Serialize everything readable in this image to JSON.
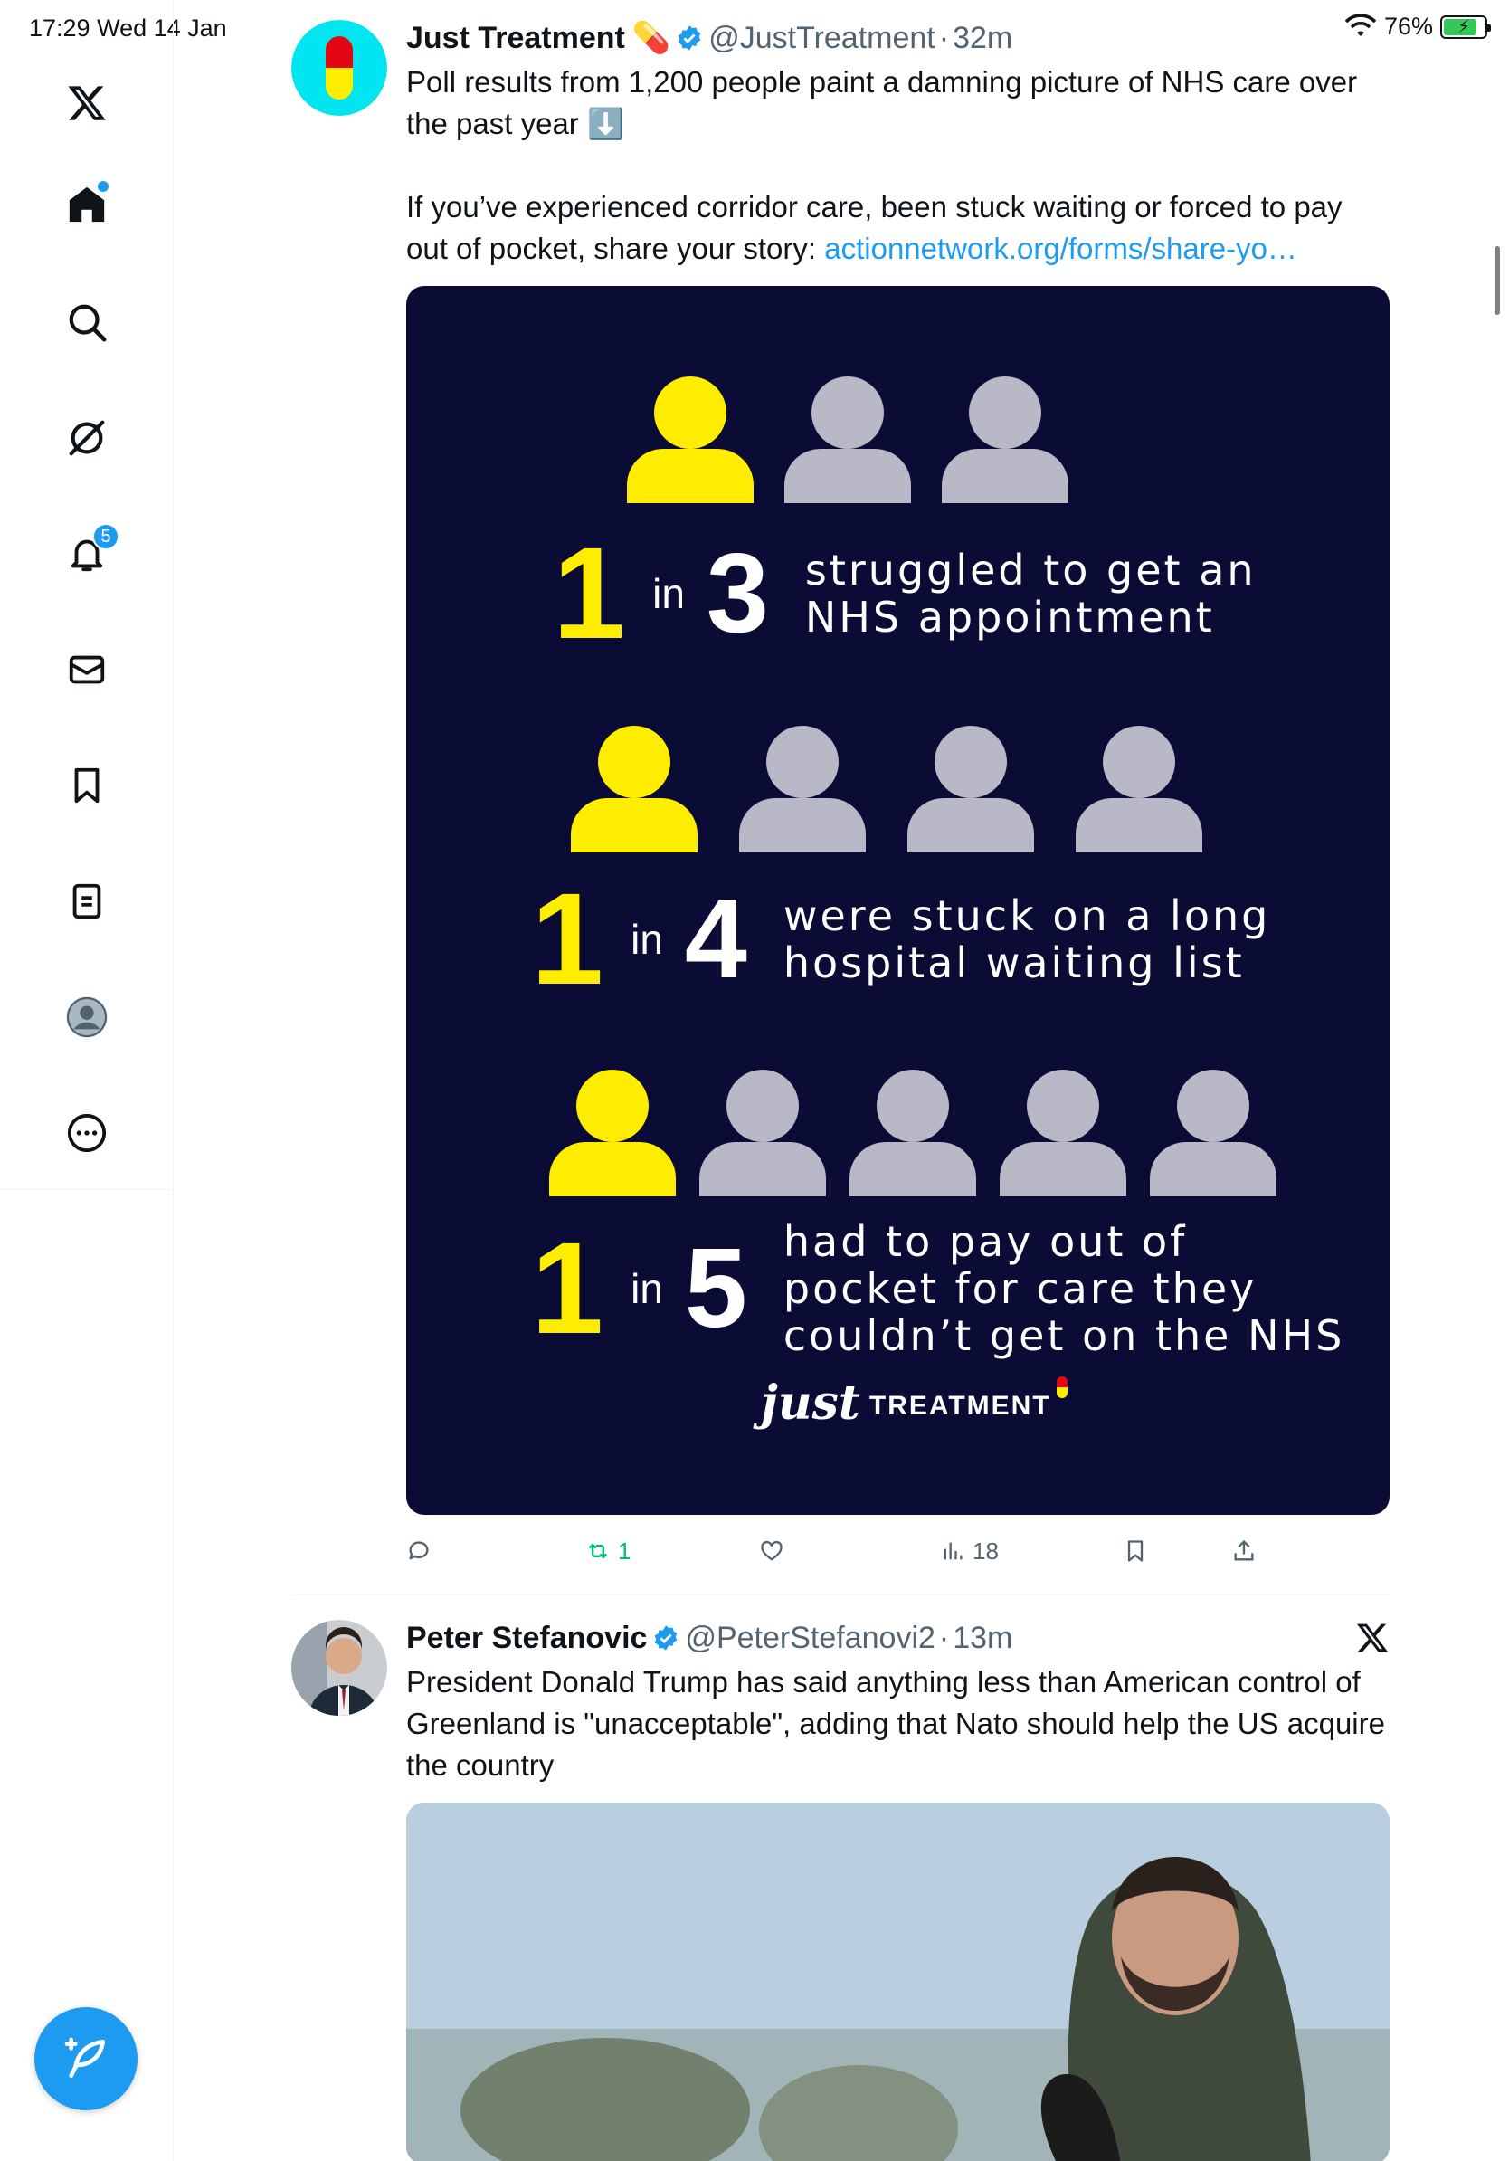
{
  "status_bar": {
    "time": "17:29  Wed 14 Jan",
    "battery_percent": "76%"
  },
  "sidebar": {
    "items": [
      {
        "name": "x-logo",
        "label": "X"
      },
      {
        "name": "home",
        "label": "Home"
      },
      {
        "name": "search",
        "label": "Explore"
      },
      {
        "name": "grok",
        "label": "Grok"
      },
      {
        "name": "notifications",
        "label": "Notifications",
        "badge": "5"
      },
      {
        "name": "messages",
        "label": "Messages"
      },
      {
        "name": "bookmarks",
        "label": "Bookmarks"
      },
      {
        "name": "lists",
        "label": "Lists"
      },
      {
        "name": "profile",
        "label": "Profile"
      },
      {
        "name": "more",
        "label": "More"
      }
    ]
  },
  "tweets": [
    {
      "author": "Just Treatment",
      "name_emoji": "💊",
      "handle": "@JustTreatment",
      "time": "32m",
      "text_line1": "Poll results from 1,200 people paint a damning picture of NHS care over the past year ⬇️",
      "text_line2": "If you’ve experienced corridor care, been stuck waiting or forced to pay out of pocket, share your story: ",
      "link": "actionnetwork.org/forms/share-yo…",
      "infographic": {
        "stats": [
          {
            "one": "1",
            "in": "in",
            "den": "3",
            "text_a": "struggled to get an",
            "text_b": "NHS appointment",
            "text_c": ""
          },
          {
            "one": "1",
            "in": "in",
            "den": "4",
            "text_a": "were stuck on a long",
            "text_b": "hospital waiting list",
            "text_c": ""
          },
          {
            "one": "1",
            "in": "in",
            "den": "5",
            "text_a": "had to pay out of",
            "text_b": "pocket for care they",
            "text_c": "couldn’t get on the NHS"
          }
        ],
        "brand_just": "just",
        "brand_treatment": "TREATMENT",
        "colors": {
          "bg": "#0b0c36",
          "highlight": "#ffed00",
          "figure": "#b9b8c6"
        }
      },
      "actions": {
        "replies": "",
        "reposts": "1",
        "likes": "",
        "views": "18"
      }
    },
    {
      "author": "Peter Stefanovic",
      "handle": "@PeterStefanovi2",
      "time": "13m",
      "text": "President Donald Trump has said anything less than American control of Greenland is \"unacceptable\", adding that Nato should help the US acquire the country"
    }
  ]
}
